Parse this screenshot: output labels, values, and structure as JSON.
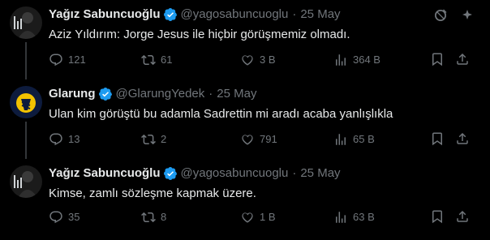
{
  "tweets": [
    {
      "name": "Yağız Sabuncuoğlu",
      "handle": "@yagosabuncuoglu",
      "separator": "·",
      "time": "25 May",
      "text": "Aziz Yıldırım: Jorge Jesus ile hiçbir görüşmemiz olmadı.",
      "replies": "121",
      "retweets": "61",
      "likes": "3 B",
      "views": "364 B"
    },
    {
      "name": "Glarung",
      "handle": "@GlarungYedek",
      "separator": "·",
      "time": "25 May",
      "text": "Ulan kim görüştü bu adamla Sadrettin mi aradı acaba yanlışlıkla",
      "replies": "13",
      "retweets": "2",
      "likes": "791",
      "views": "65 B"
    },
    {
      "name": "Yağız Sabuncuoğlu",
      "handle": "@yagosabuncuoglu",
      "separator": "·",
      "time": "25 May",
      "text": "Kimse, zamlı sözleşme kapmak üzere.",
      "replies": "35",
      "retweets": "8",
      "likes": "1 B",
      "views": "63 B"
    }
  ],
  "colors": {
    "background": "#000000",
    "text": "#e7e9ea",
    "muted": "#71767b",
    "verified": "#1d9bf0",
    "thread_line": "#333639"
  },
  "icons": [
    "grok-icon",
    "more-icon",
    "reply-icon",
    "retweet-icon",
    "like-icon",
    "views-icon",
    "bookmark-icon",
    "share-icon",
    "verified-badge-icon"
  ]
}
